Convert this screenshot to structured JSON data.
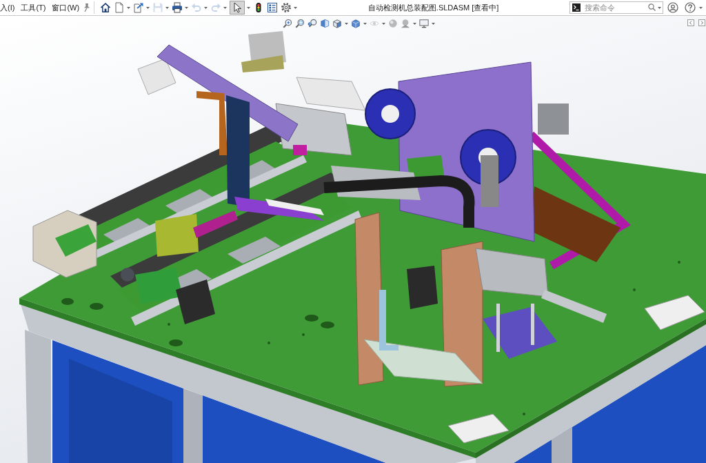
{
  "menu": [
    {
      "label": "入(I)"
    },
    {
      "label": "工具(T)"
    },
    {
      "label": "窗口(W)"
    }
  ],
  "quick_toolbar": [
    {
      "kind": "home",
      "dropdown": false,
      "disabled": false,
      "pressed": false
    },
    {
      "kind": "new",
      "dropdown": true,
      "disabled": false,
      "pressed": false
    },
    {
      "kind": "open",
      "dropdown": true,
      "disabled": false,
      "pressed": false
    },
    {
      "kind": "save",
      "dropdown": true,
      "disabled": true,
      "pressed": false
    },
    {
      "kind": "print",
      "dropdown": true,
      "disabled": false,
      "pressed": false
    },
    {
      "kind": "undo",
      "dropdown": true,
      "disabled": true,
      "pressed": false
    },
    {
      "kind": "redo",
      "dropdown": true,
      "disabled": true,
      "pressed": false
    },
    {
      "kind": "select",
      "dropdown": true,
      "disabled": false,
      "pressed": true
    },
    {
      "kind": "rebuild",
      "dropdown": false,
      "disabled": false,
      "pressed": false
    },
    {
      "kind": "file_properties",
      "dropdown": false,
      "disabled": false,
      "pressed": false
    },
    {
      "kind": "options",
      "dropdown": true,
      "disabled": false,
      "pressed": false
    }
  ],
  "title": "自动检测机总装配图.SLDASM [查看中]",
  "search": {
    "placeholder": "搜索命令"
  },
  "view_toolbar": [
    {
      "kind": "zoom_to_fit",
      "dropdown": false,
      "disabled": false
    },
    {
      "kind": "zoom_to_area",
      "dropdown": false,
      "disabled": false
    },
    {
      "kind": "previous_view",
      "dropdown": false,
      "disabled": false
    },
    {
      "kind": "section_view",
      "dropdown": false,
      "disabled": false
    },
    {
      "kind": "view_orientation",
      "dropdown": true,
      "disabled": false
    },
    {
      "kind": "display_style",
      "dropdown": true,
      "disabled": false
    },
    {
      "kind": "hide_show",
      "dropdown": true,
      "disabled": true
    },
    {
      "kind": "edit_appearance",
      "dropdown": false,
      "disabled": false
    },
    {
      "kind": "apply_scene",
      "dropdown": true,
      "disabled": false
    },
    {
      "kind": "view_settings",
      "dropdown": true,
      "disabled": false
    }
  ]
}
